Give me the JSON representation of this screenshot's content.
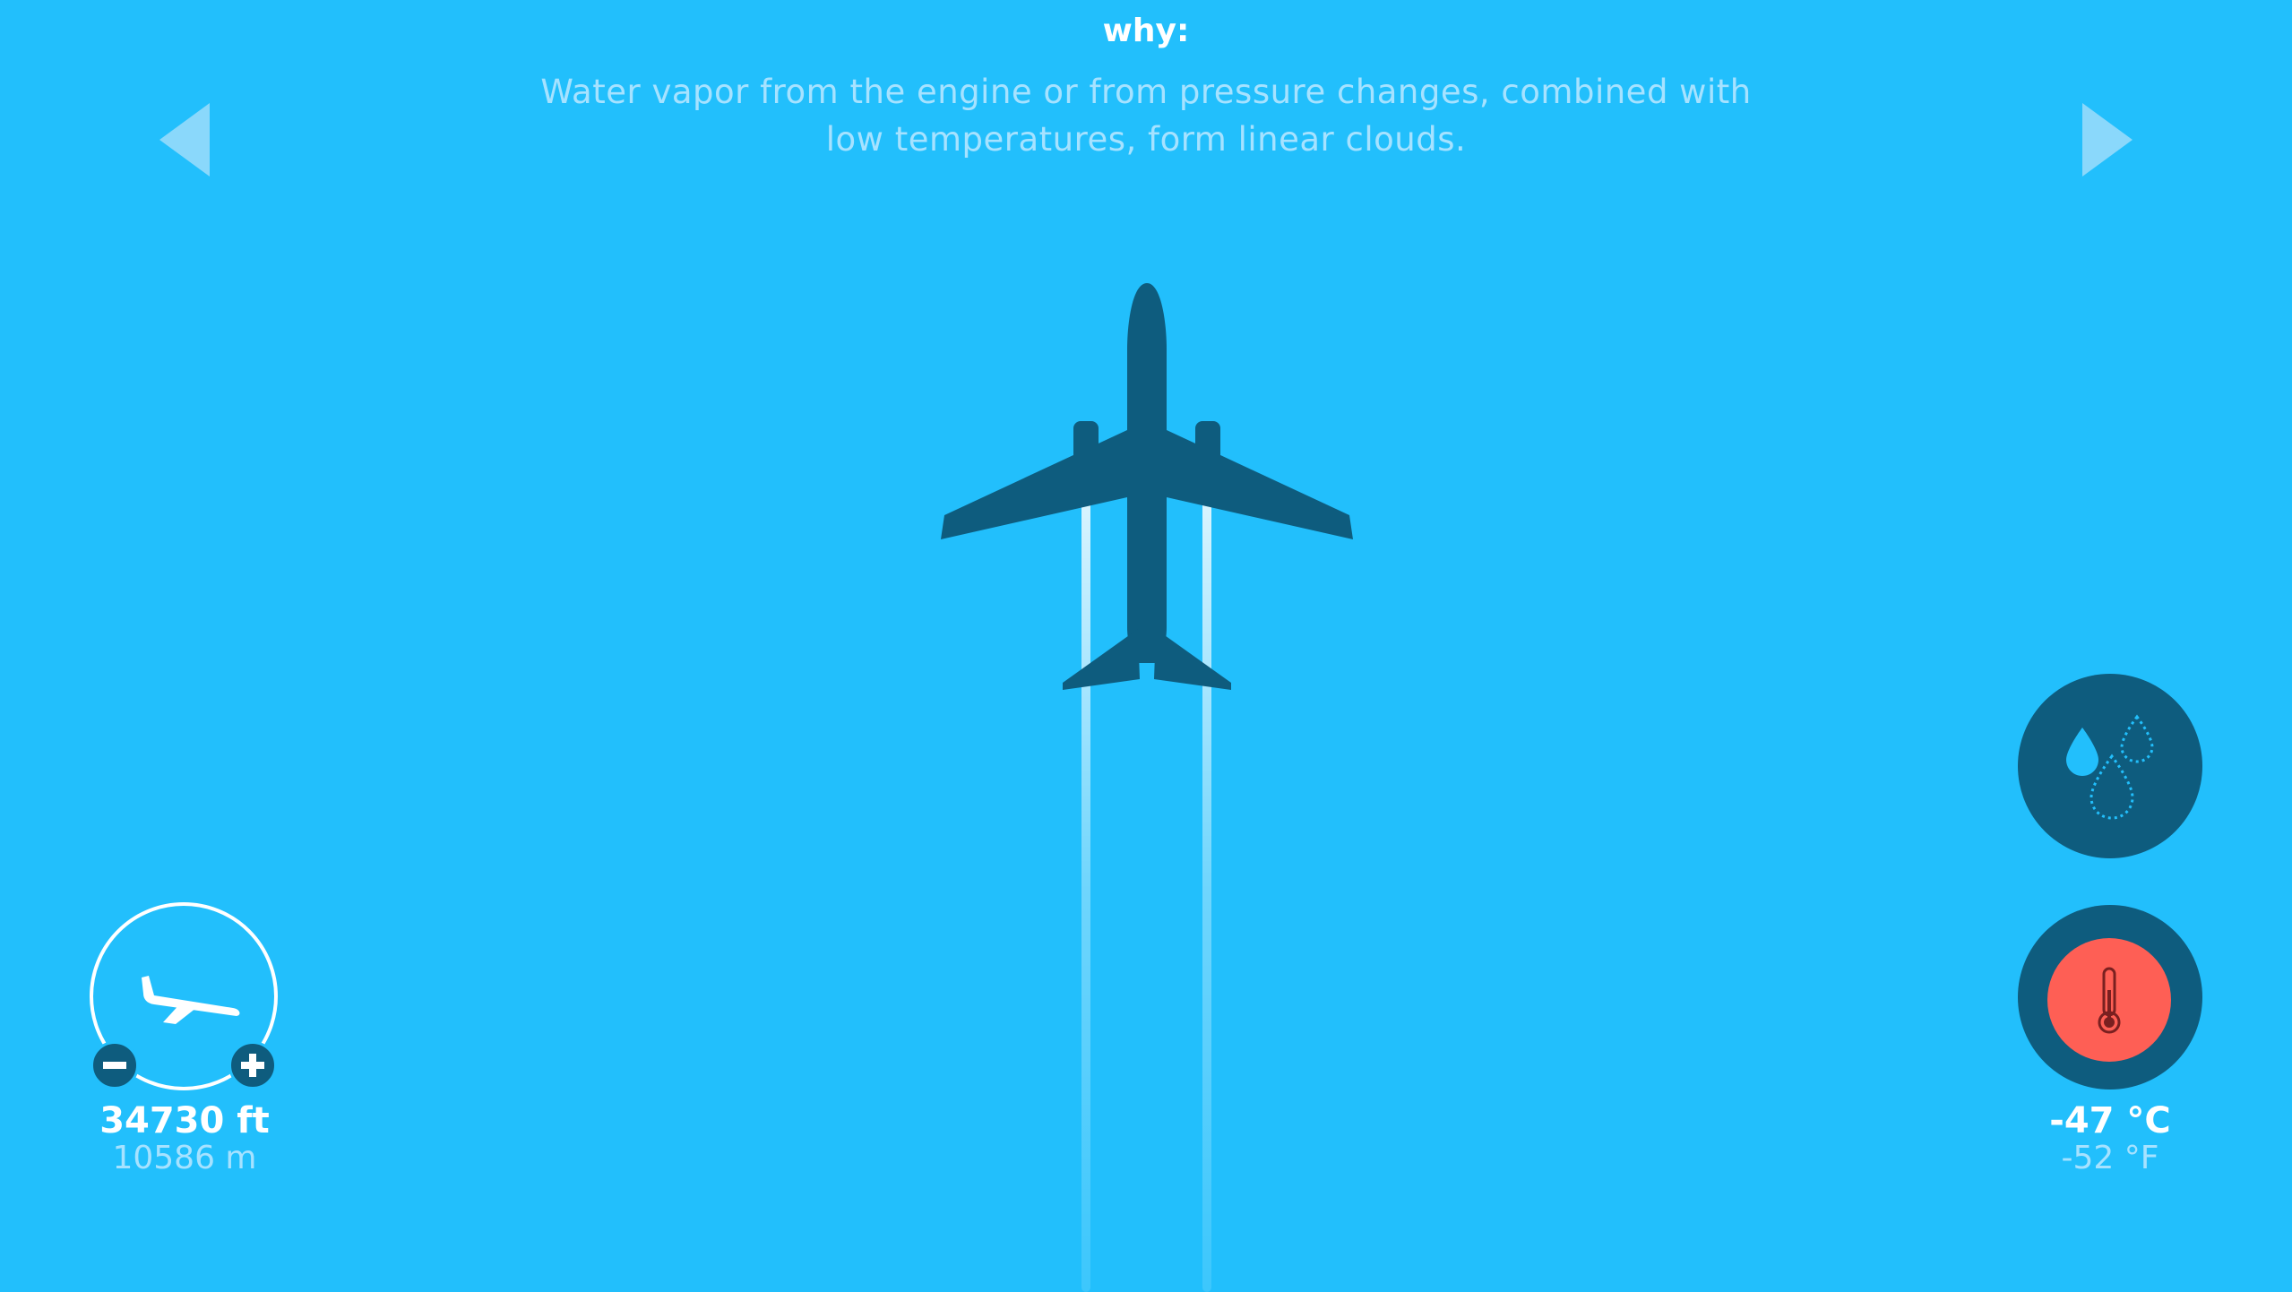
{
  "explanation": {
    "heading": "why:",
    "text": "Water vapor from the engine or from pressure changes, combined with low temperatures, form linear clouds."
  },
  "navigation": {
    "previous_icon": "triangle-left-icon",
    "next_icon": "triangle-right-icon"
  },
  "aircraft": {
    "icon": "airplane-top-view-icon",
    "contrails": true
  },
  "altitude": {
    "feet_label": "34730 ft",
    "meters_label": "10586 m",
    "decrease_icon": "minus-icon",
    "increase_icon": "plus-icon",
    "dial_icon": "airplane-descending-icon"
  },
  "humidity": {
    "icon": "water-drops-icon",
    "selected": false
  },
  "temperature": {
    "icon": "thermometer-icon",
    "celsius_label": "-47 °C",
    "fahrenheit_label": "-52 °F",
    "selected": true
  },
  "colors": {
    "sky": "#22bffc",
    "plane_shadow": "#0e5c7e",
    "temperature_active": "#fe5f55",
    "secondary_text": "#a6e2ff",
    "primary_text": "#ffffff"
  }
}
